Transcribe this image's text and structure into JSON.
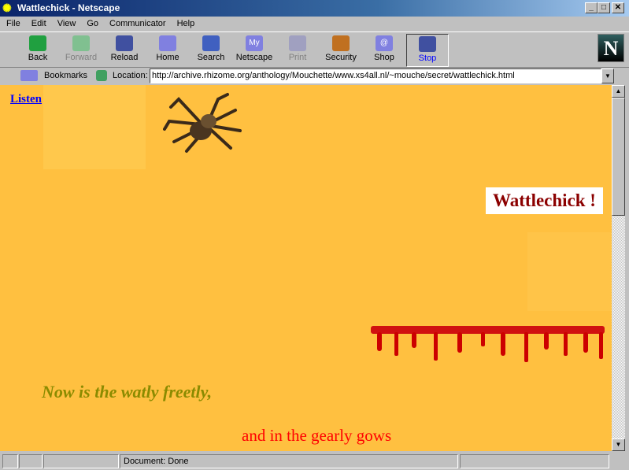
{
  "window": {
    "title": "Wattlechick - Netscape",
    "minimize": "_",
    "maximize": "□",
    "close": "✕"
  },
  "menu": [
    "File",
    "Edit",
    "View",
    "Go",
    "Communicator",
    "Help"
  ],
  "toolbar": [
    {
      "label": "Back",
      "color": "#20a040",
      "state": "enabled"
    },
    {
      "label": "Forward",
      "color": "#80c090",
      "state": "disabled"
    },
    {
      "label": "Reload",
      "color": "#4050a0",
      "state": "enabled"
    },
    {
      "label": "Home",
      "color": "#8080e0",
      "state": "enabled"
    },
    {
      "label": "Search",
      "color": "#4060c0",
      "state": "enabled"
    },
    {
      "label": "Netscape",
      "color": "#8080e0",
      "state": "enabled",
      "icon_text": "My"
    },
    {
      "label": "Print",
      "color": "#a0a0c0",
      "state": "disabled"
    },
    {
      "label": "Security",
      "color": "#c07020",
      "state": "enabled"
    },
    {
      "label": "Shop",
      "color": "#8080e0",
      "state": "enabled",
      "icon_text": "@"
    },
    {
      "label": "Stop",
      "color": "#4050a0",
      "state": "active"
    }
  ],
  "location": {
    "bookmarks": "Bookmarks",
    "label": "Location:",
    "url": "http://archive.rhizome.org/anthology/Mouchette/www.xs4all.nl/~mouche/secret/wattlechick.html"
  },
  "page": {
    "listen": "Listen",
    "title": "Wattlechick !",
    "line1": "Now is the watly freetly,",
    "line2": "and in the gearly gows",
    "bg": "#ffc040"
  },
  "status": {
    "text": "Document: Done"
  }
}
